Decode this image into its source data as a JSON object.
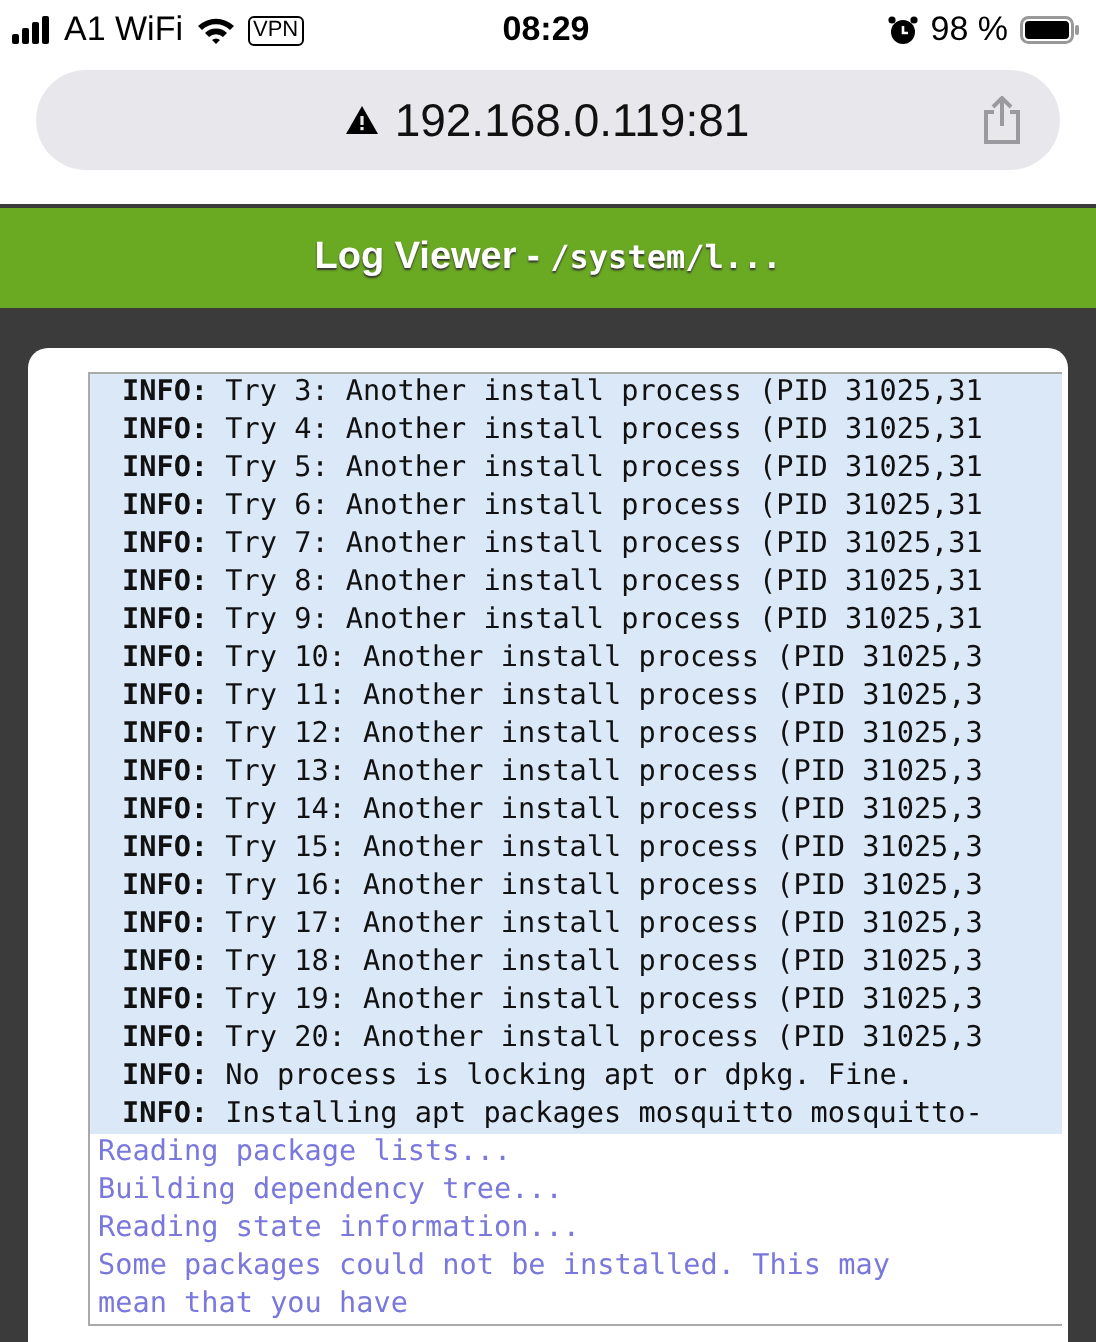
{
  "status_bar": {
    "carrier": "A1 WiFi",
    "vpn": "VPN",
    "time": "08:29",
    "battery": "98 %"
  },
  "address_bar": {
    "url": "192.168.0.119:81"
  },
  "header": {
    "title": "Log Viewer - ",
    "path": "/system/l..."
  },
  "log": [
    {
      "kind": "info",
      "label": "INFO:",
      "text": "Try 3: Another install process (PID 31025,31"
    },
    {
      "kind": "info",
      "label": "INFO:",
      "text": "Try 4: Another install process (PID 31025,31"
    },
    {
      "kind": "info",
      "label": "INFO:",
      "text": "Try 5: Another install process (PID 31025,31"
    },
    {
      "kind": "info",
      "label": "INFO:",
      "text": "Try 6: Another install process (PID 31025,31"
    },
    {
      "kind": "info",
      "label": "INFO:",
      "text": "Try 7: Another install process (PID 31025,31"
    },
    {
      "kind": "info",
      "label": "INFO:",
      "text": "Try 8: Another install process (PID 31025,31"
    },
    {
      "kind": "info",
      "label": "INFO:",
      "text": "Try 9: Another install process (PID 31025,31"
    },
    {
      "kind": "info",
      "label": "INFO:",
      "text": "Try 10: Another install process (PID 31025,3"
    },
    {
      "kind": "info",
      "label": "INFO:",
      "text": "Try 11: Another install process (PID 31025,3"
    },
    {
      "kind": "info",
      "label": "INFO:",
      "text": "Try 12: Another install process (PID 31025,3"
    },
    {
      "kind": "info",
      "label": "INFO:",
      "text": "Try 13: Another install process (PID 31025,3"
    },
    {
      "kind": "info",
      "label": "INFO:",
      "text": "Try 14: Another install process (PID 31025,3"
    },
    {
      "kind": "info",
      "label": "INFO:",
      "text": "Try 15: Another install process (PID 31025,3"
    },
    {
      "kind": "info",
      "label": "INFO:",
      "text": "Try 16: Another install process (PID 31025,3"
    },
    {
      "kind": "info",
      "label": "INFO:",
      "text": "Try 17: Another install process (PID 31025,3"
    },
    {
      "kind": "info",
      "label": "INFO:",
      "text": "Try 18: Another install process (PID 31025,3"
    },
    {
      "kind": "info",
      "label": "INFO:",
      "text": "Try 19: Another install process (PID 31025,3"
    },
    {
      "kind": "info",
      "label": "INFO:",
      "text": "Try 20: Another install process (PID 31025,3"
    },
    {
      "kind": "info",
      "label": "INFO:",
      "text": "No process is locking apt or dpkg. Fine."
    },
    {
      "kind": "info",
      "label": "INFO:",
      "text": "Installing apt packages mosquitto mosquitto-"
    },
    {
      "kind": "output",
      "text": "Reading package lists..."
    },
    {
      "kind": "output",
      "text": "Building dependency tree..."
    },
    {
      "kind": "output",
      "text": "Reading state information..."
    },
    {
      "kind": "output",
      "text": "Some packages could not be installed. This may"
    },
    {
      "kind": "output",
      "text": "mean that you have"
    }
  ]
}
